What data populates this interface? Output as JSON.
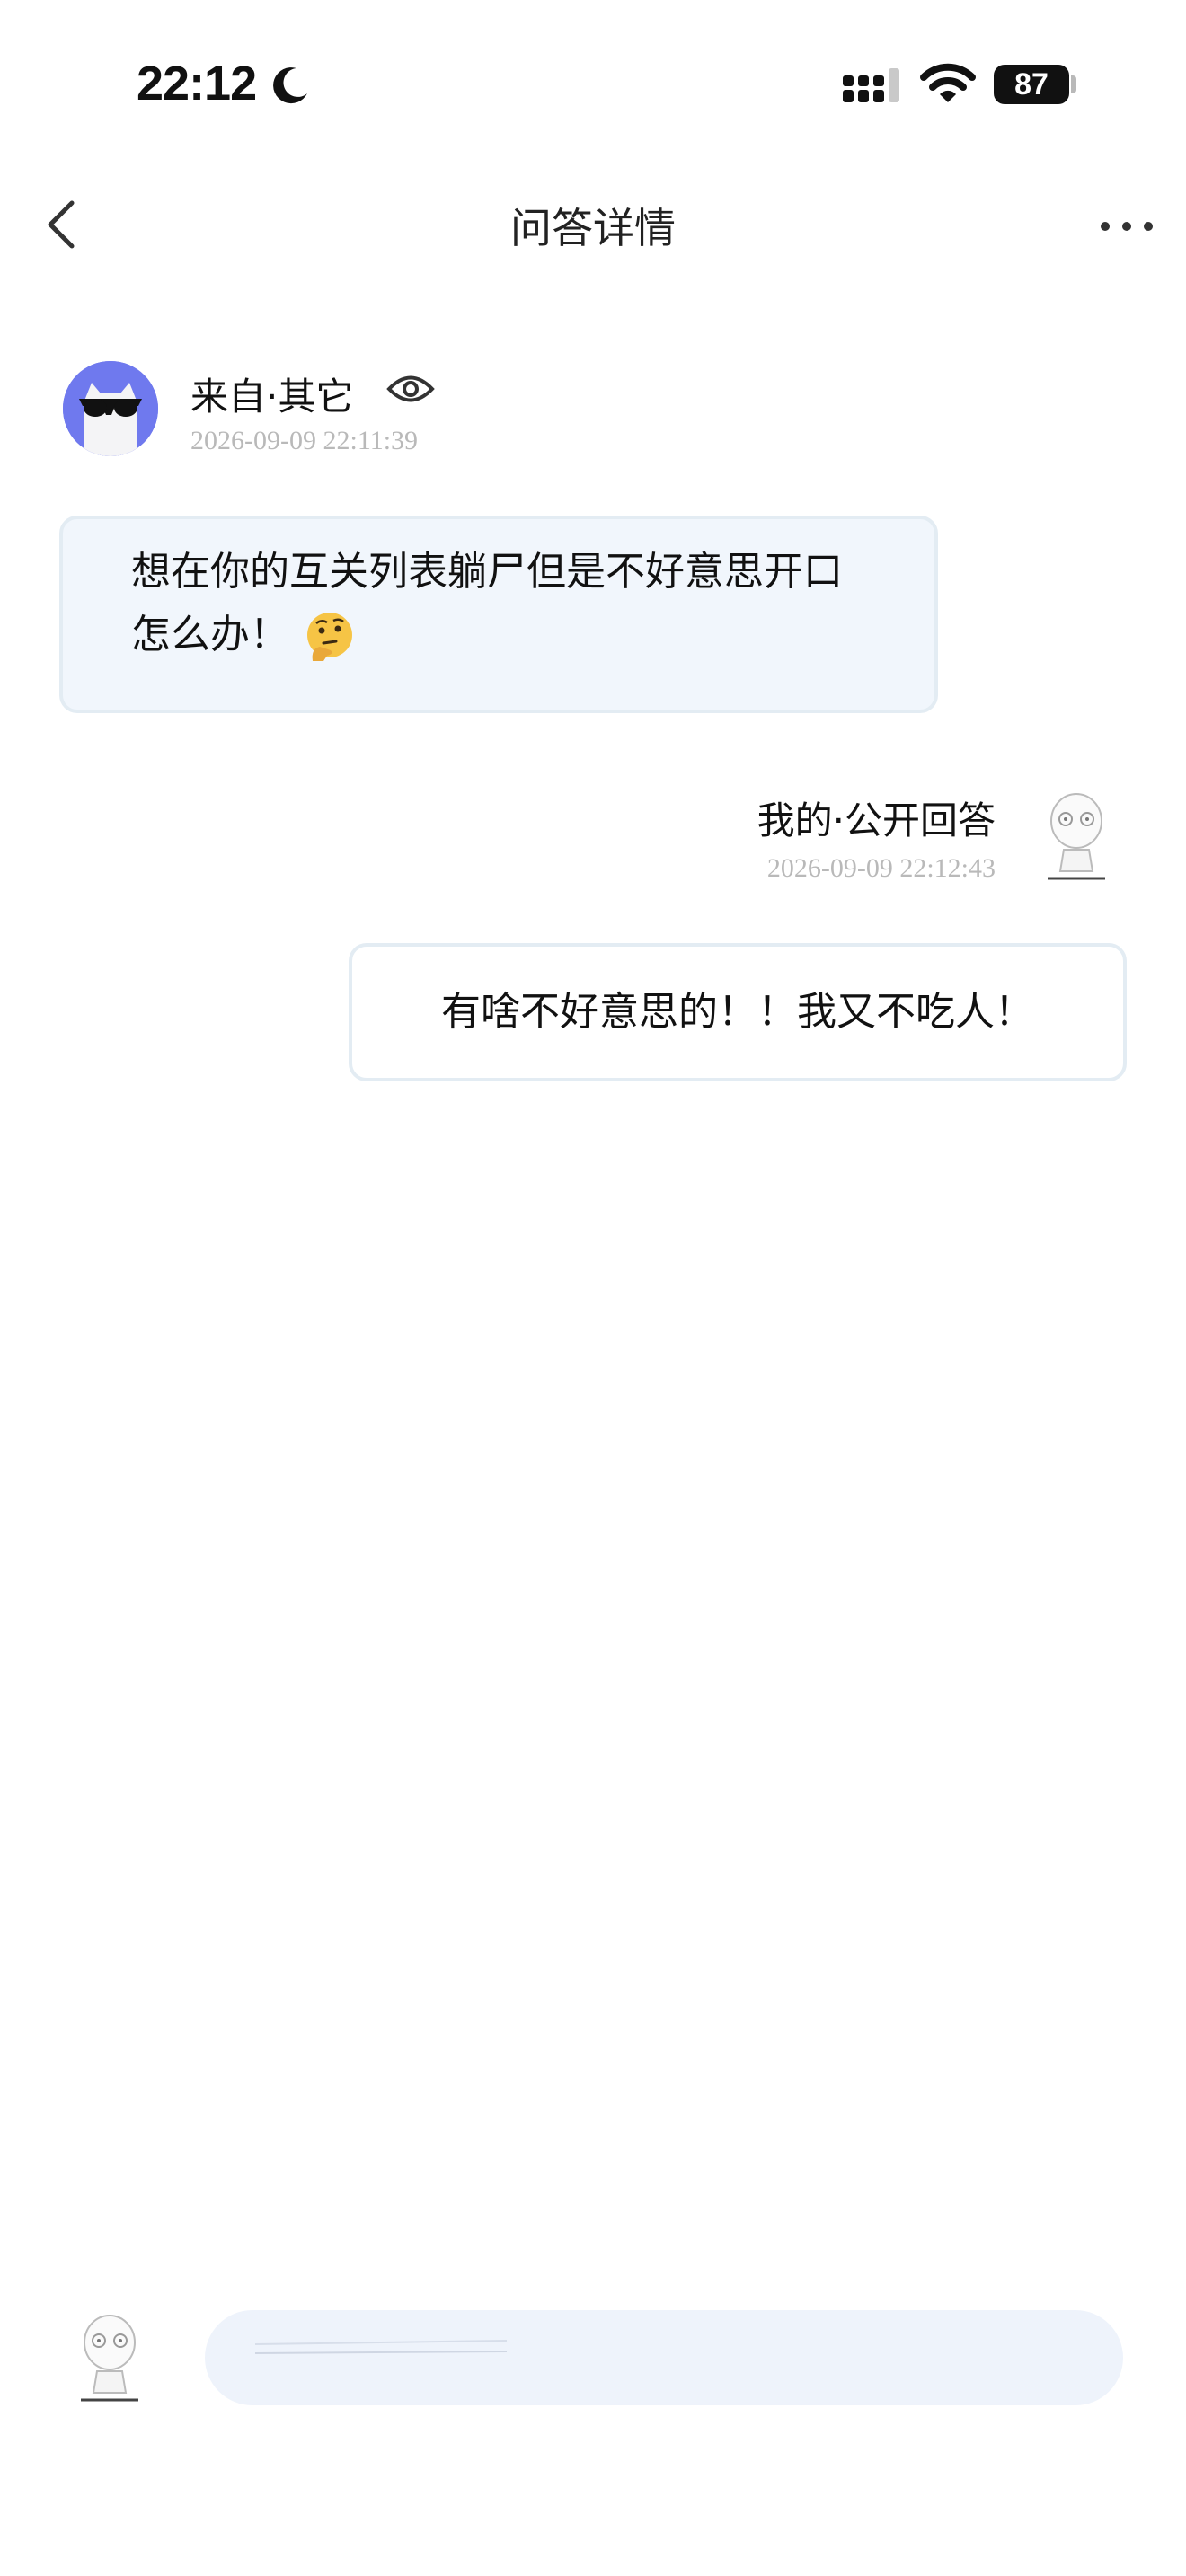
{
  "status_bar": {
    "time": "22:12",
    "battery": "87"
  },
  "nav": {
    "title": "问答详情"
  },
  "question": {
    "source": "来自·其它",
    "timestamp": "2026-09-09 22:11:39",
    "text": "想在你的互关列表躺尸但是不好意思开口怎么办！",
    "emoji": "thinking-face-icon"
  },
  "answer": {
    "label": "我的·公开回答",
    "timestamp": "2026-09-09 22:12:43",
    "text": "有啥不好意思的！！我又不吃人！"
  },
  "reply_box": {
    "placeholder": ""
  },
  "colors": {
    "avatar_bg": "#6f79ee",
    "question_bubble_bg": "#f1f6fc",
    "bubble_border": "#e3ecf3",
    "input_bg": "#eef3fb",
    "timestamp": "#b9b9b9"
  }
}
